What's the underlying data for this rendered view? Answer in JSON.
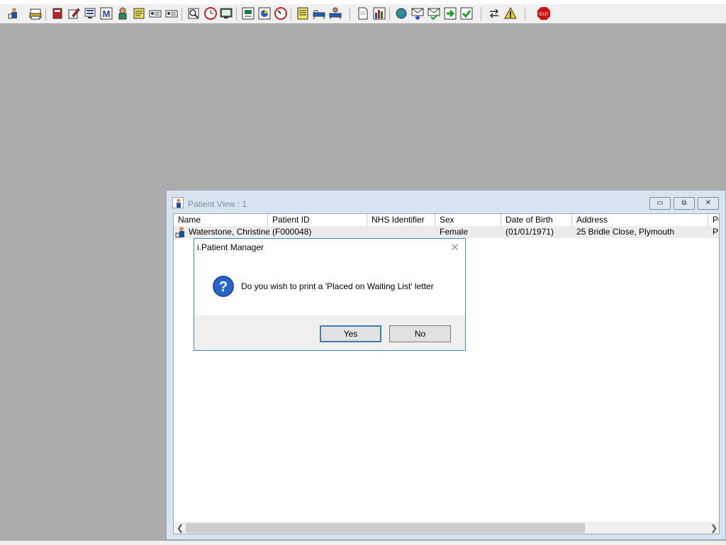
{
  "toolbar": {
    "icons": [
      "patient-icon",
      "print-icon",
      "book-icon",
      "edit-icon",
      "monitor-list-icon",
      "m-icon",
      "person-icon",
      "notes-icon",
      "waiting-list-icon",
      "waiting-list-2-icon",
      "search-icon",
      "clock-icon",
      "screen-icon",
      "report-icon",
      "chart-icon",
      "dial-icon",
      "memo-icon",
      "bed-icon",
      "transfer-icon",
      "document-icon",
      "bar-chart-icon",
      "globe-icon",
      "mail-down-icon",
      "mail-check-icon",
      "green-arrow-icon",
      "green-check-icon",
      "swap-icon",
      "warning-icon",
      "exit-icon"
    ],
    "exit_label": "EXIT"
  },
  "window": {
    "title": "Patient View : 1",
    "minimize_label": "▭",
    "maximize_label": "⧉",
    "close_label": "✕"
  },
  "table": {
    "columns": [
      "Name",
      "Patient ID",
      "NHS Identifier",
      "Sex",
      "Date of Birth",
      "Address",
      "Po"
    ],
    "rows": [
      {
        "name": "Waterstone, Christine...",
        "patient_id": "(F000048)",
        "nhs": "",
        "sex": "Female",
        "dob": "(01/01/1971)",
        "address": "25 Bridle Close, Plymouth",
        "post": "PL"
      }
    ]
  },
  "dialog": {
    "title": "i.Patient Manager",
    "close_label": "✕",
    "message": "Do you wish to print  a 'Placed on Waiting List' letter",
    "yes_label": "Yes",
    "no_label": "No"
  },
  "colors": {
    "desktop": "#ababab",
    "accent": "#4a86c8"
  }
}
